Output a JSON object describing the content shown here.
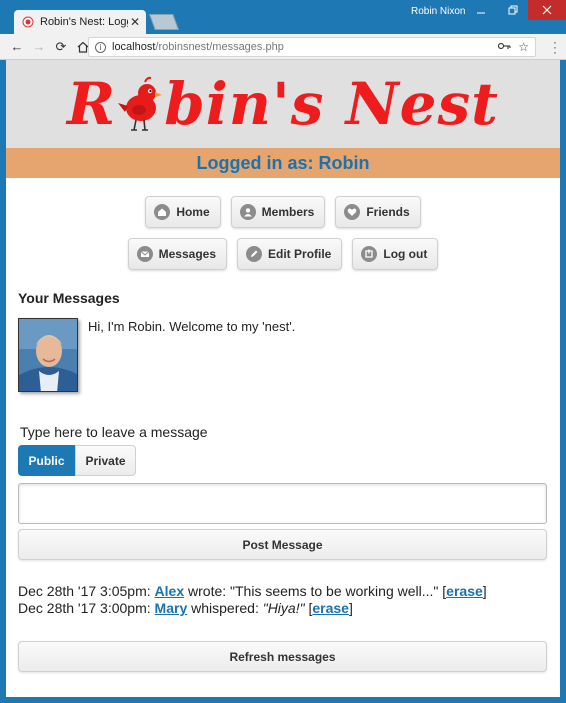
{
  "browser": {
    "tab_title": "Robin's Nest: Logged in a",
    "user": "Robin Nixon",
    "url_host": "localhost",
    "url_path": "/robinsnest/messages.php"
  },
  "site": {
    "logo_pre": "R",
    "logo_post": "bin's Nest",
    "logged_in": "Logged in as: Robin"
  },
  "nav": {
    "home": "Home",
    "members": "Members",
    "friends": "Friends",
    "messages": "Messages",
    "edit_profile": "Edit Profile",
    "logout": "Log out"
  },
  "profile": {
    "heading": "Your Messages",
    "intro": "Hi, I'm Robin. Welcome to my 'nest'."
  },
  "compose": {
    "prompt": "Type here to leave a message",
    "public": "Public",
    "private": "Private",
    "post": "Post Message"
  },
  "messages": [
    {
      "date": "Dec 28th '17 3:05pm:",
      "author": "Alex",
      "verb": "wrote:",
      "text": "\"This seems to be working well...\"",
      "erase": "erase"
    },
    {
      "date": "Dec 28th '17 3:00pm:",
      "author": "Mary",
      "verb": "whispered:",
      "text": "\"Hiya!\"",
      "erase": "erase"
    }
  ],
  "refresh": "Refresh messages",
  "colors": {
    "brand_red": "#ee1c1c",
    "accent_blue": "#1d79b3",
    "userbar": "#e6a46e"
  }
}
